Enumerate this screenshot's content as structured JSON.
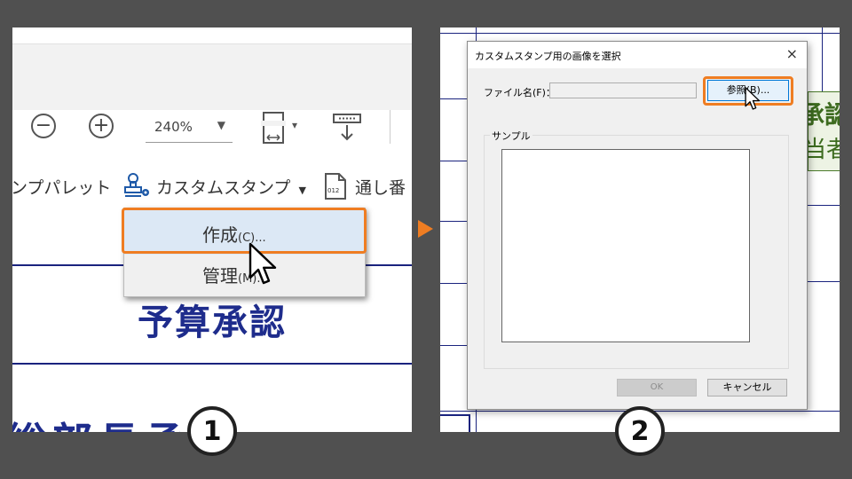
{
  "panel1": {
    "toolbar": {
      "zoom_out_symbol": "−",
      "zoom_in_symbol": "+",
      "zoom_value": "240%",
      "zoom_arrow": "▼",
      "fit_arrow": "▾"
    },
    "menu_row": {
      "stamp_palette_label": "ンプパレット",
      "custom_stamp_label": "カスタムスタンプ",
      "custom_stamp_arrow": "▼",
      "bates_label": "通し番",
      "bates_icon_text": "012"
    },
    "dropdown": {
      "create_label": "作成",
      "create_accel": "(C)...",
      "manage_label": "管理",
      "manage_accel": "(M)..."
    },
    "document": {
      "title": "予算承認",
      "title_partial": "総部長承認"
    }
  },
  "panel2": {
    "dialog": {
      "title": "カスタムスタンプ用の画像を選択",
      "close_symbol": "×",
      "file_label": "ファイル名(F)：",
      "file_value": "",
      "browse_label": "参照(B)...",
      "sample_label": "サンプル",
      "ok_label": "OK",
      "cancel_label": "キャンセル"
    },
    "stamp_peek": {
      "line1": "承認",
      "line2": "当者"
    }
  },
  "steps": [
    "1",
    "2"
  ],
  "colors": {
    "background": "#505050",
    "highlight": "#ef7d22",
    "document_blue": "#1e2c8c",
    "stamp_green": "#3d6b1f"
  }
}
